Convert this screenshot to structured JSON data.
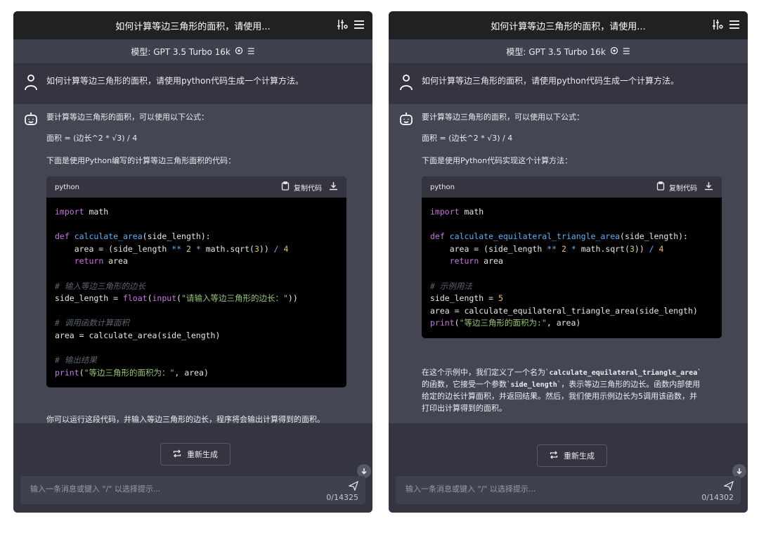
{
  "left": {
    "title": "如何计算等边三角形的面积，请使用...",
    "model_label": "模型: GPT 3.5 Turbo 16k",
    "user_message": "如何计算等边三角形的面积，请使用python代码生成一个计算方法。",
    "bot_intro": "要计算等边三角形的面积，可以使用以下公式：",
    "formula": "面积 = (边长^2 * √3) / 4",
    "bot_lead": "下面是使用Python编写的计算等边三角形面积的代码：",
    "code_lang": "python",
    "copy_label": "复制代码",
    "bot_outro": "你可以运行这段代码，并输入等边三角形的边长，程序将会输出计算得到的面积。",
    "regen_label": "重新生成",
    "input_placeholder": "输入一条消息或键入 \"/\" 以选择提示...",
    "char_count": "0/14325"
  },
  "right": {
    "title": "如何计算等边三角形的面积，请使用...",
    "model_label": "模型: GPT 3.5 Turbo 16k",
    "user_message": "如何计算等边三角形的面积，请使用python代码生成一个计算方法。",
    "bot_intro": "要计算等边三角形的面积，可以使用以下公式：",
    "formula": "面积 = (边长^2 * √3) / 4",
    "bot_lead": "下面是使用Python代码实现这个计算方法：",
    "code_lang": "python",
    "copy_label": "复制代码",
    "explain_1a": "在这个示例中，我们定义了一个名为`",
    "explain_1b": "calculate_equilateral_triangle_area",
    "explain_1c": "`",
    "explain_2a": "的函数，它接受一个参数`",
    "explain_2b": "side_length",
    "explain_2c": "`，表示等边三角形的边长。函数内部使用",
    "explain_3": "给定的边长计算面积，并返回结果。然后，我们使用示例边长为5调用该函数，并",
    "explain_4": "打印出计算得到的面积。",
    "regen_label": "重新生成",
    "input_placeholder": "输入一条消息或键入 \"/\" 以选择提示...",
    "char_count": "0/14302"
  },
  "icons": {
    "settings": "sliders-icon",
    "menu": "hamburger-icon",
    "model_settings": "gear-icon",
    "user": "user-icon",
    "bot": "robot-icon",
    "copy": "clipboard-icon",
    "download": "download-icon",
    "regenerate": "refresh-icon",
    "send": "send-icon",
    "scroll": "arrow-down-icon"
  },
  "colors": {
    "panel_bg": "#444654",
    "topbar_bg": "#202123",
    "code_bg": "#000000",
    "keyword": "#c678dd",
    "function": "#61afef",
    "number": "#e5c07b",
    "string": "#98c379",
    "comment": "#5c6370"
  }
}
